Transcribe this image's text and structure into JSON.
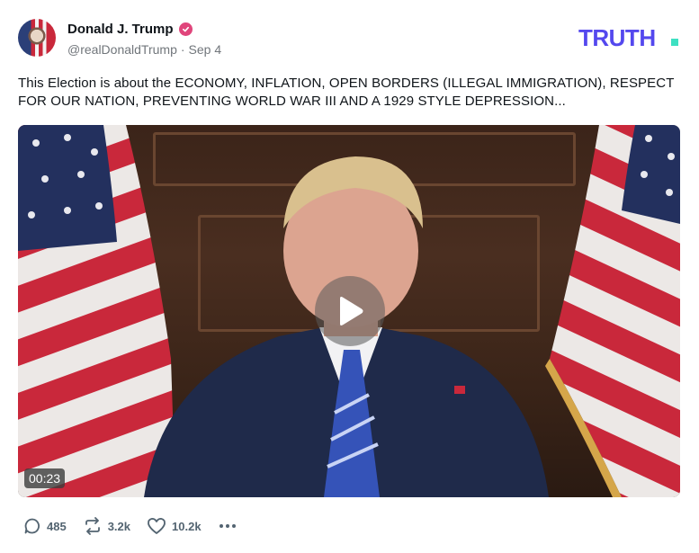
{
  "author": {
    "display_name": "Donald J. Trump",
    "handle": "@realDonaldTrump",
    "separator": "·",
    "date": "Sep 4"
  },
  "brand": {
    "logo_text": "TRUTH",
    "accent_color": "#5448ee"
  },
  "post": {
    "text": "This Election is about the ECONOMY, INFLATION, OPEN BORDERS (ILLEGAL IMMIGRATION), RESPECT FOR OUR NATION, PREVENTING WORLD WAR III AND A 1929 STYLE DEPRESSION..."
  },
  "video": {
    "duration": "00:23"
  },
  "actions": {
    "replies": "485",
    "retruths": "3.2k",
    "likes": "10.2k"
  },
  "colors": {
    "verified_badge": "#e0457b",
    "muted_text": "#71767b"
  }
}
